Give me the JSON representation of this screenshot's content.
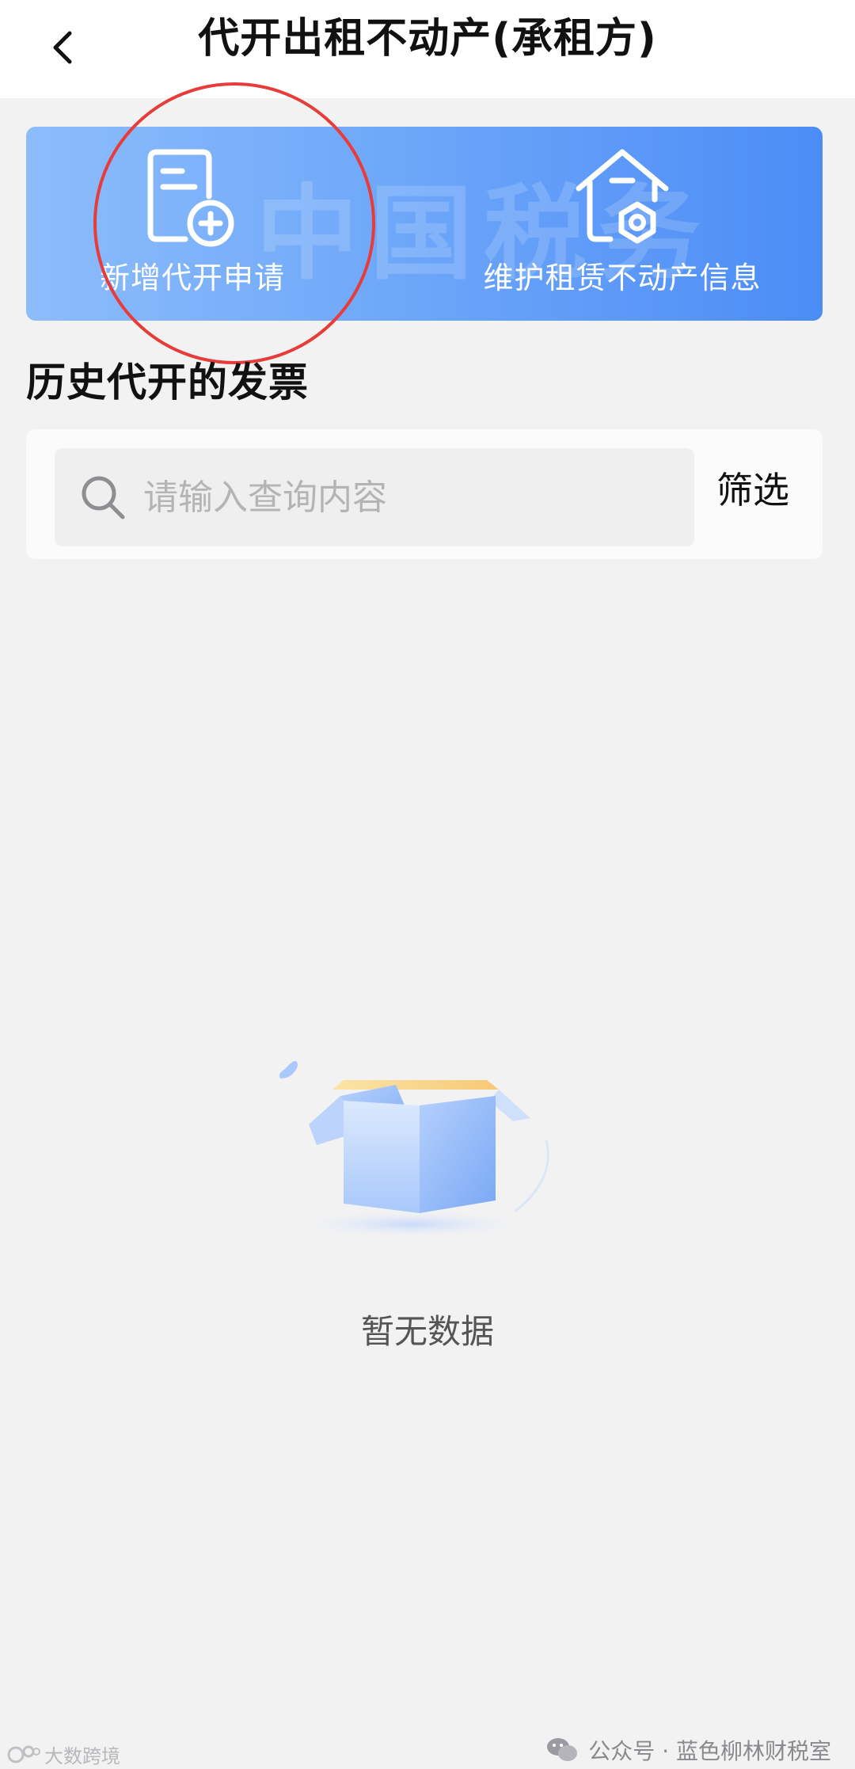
{
  "header": {
    "title": "代开出租不动产(承租方)",
    "back_icon": "chevron-left-icon"
  },
  "banner": {
    "watermark": "中国税务",
    "actions": [
      {
        "label": "新增代开申请",
        "icon": "document-add-icon"
      },
      {
        "label": "维护租赁不动产信息",
        "icon": "house-settings-icon"
      }
    ],
    "highlight_color": "#e63c3a",
    "gradient_start": "#8cbcfb",
    "gradient_end": "#4c8cf6"
  },
  "history": {
    "title": "历史代开的发票",
    "search": {
      "placeholder": "请输入查询内容",
      "value": "",
      "icon": "search-icon"
    },
    "filter_label": "筛选"
  },
  "empty_state": {
    "illustration": "empty-box-icon",
    "text": "暂无数据"
  },
  "watermarks": {
    "footer": "公众号 · 蓝色柳林财税室",
    "corner": "大数跨境"
  }
}
